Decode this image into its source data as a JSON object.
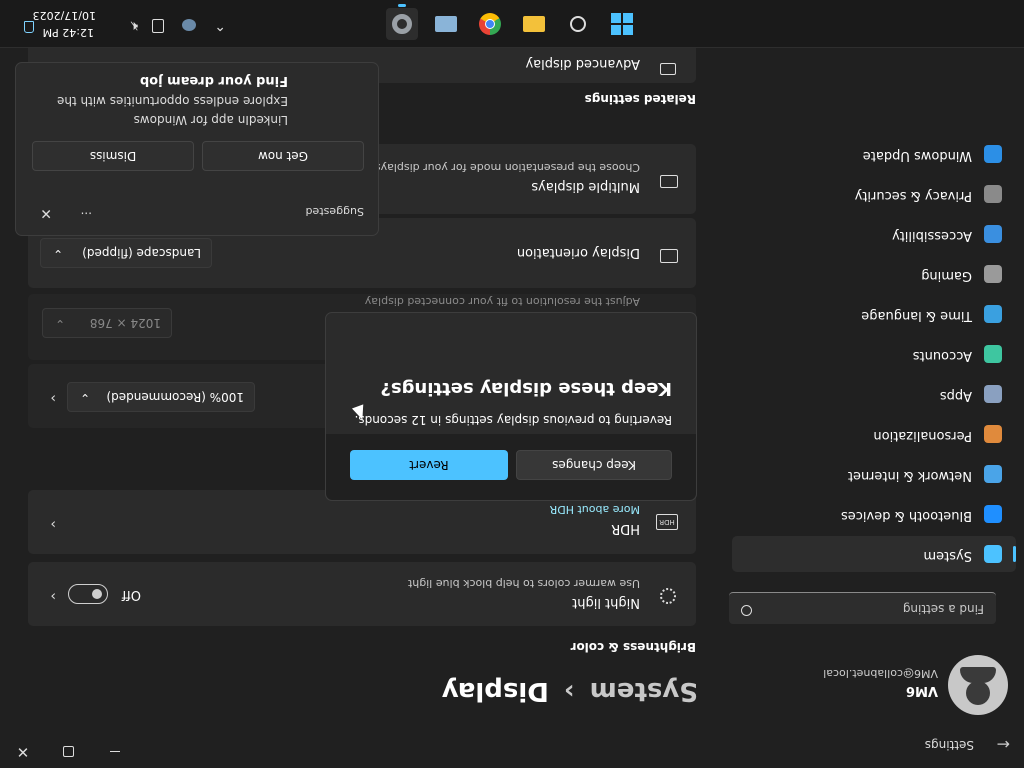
{
  "window": {
    "app_title": "Settings",
    "back_icon": "back-arrow-icon",
    "minimize_icon": "minimize-icon",
    "maximize_icon": "maximize-icon",
    "close_icon": "close-icon"
  },
  "profile": {
    "name": "VM6",
    "email": "VM6@collabnet.local"
  },
  "search": {
    "placeholder": "Find a setting"
  },
  "sidebar": {
    "items": [
      {
        "label": "System",
        "icon": "monitor-icon",
        "color": "#4cc2ff",
        "selected": true
      },
      {
        "label": "Bluetooth & devices",
        "icon": "bluetooth-icon",
        "color": "#1f8fff"
      },
      {
        "label": "Network & internet",
        "icon": "wifi-icon",
        "color": "#4aa4e8"
      },
      {
        "label": "Personalization",
        "icon": "brush-icon",
        "color": "#e08a3c"
      },
      {
        "label": "Apps",
        "icon": "apps-icon",
        "color": "#8aa0c0"
      },
      {
        "label": "Accounts",
        "icon": "person-icon",
        "color": "#3ec6a0"
      },
      {
        "label": "Time & language",
        "icon": "globe-clock-icon",
        "color": "#3aa0e0"
      },
      {
        "label": "Gaming",
        "icon": "gamepad-icon",
        "color": "#9a9a9a"
      },
      {
        "label": "Accessibility",
        "icon": "accessibility-icon",
        "color": "#3a8fe0"
      },
      {
        "label": "Privacy & security",
        "icon": "shield-icon",
        "color": "#8a8a8a"
      },
      {
        "label": "Windows Update",
        "icon": "sync-icon",
        "color": "#2c8fe6"
      }
    ]
  },
  "breadcrumb": {
    "parent": "System",
    "separator": "›",
    "current": "Display"
  },
  "sections": {
    "brightness": "Brightness & color",
    "related": "Related settings"
  },
  "night_light": {
    "title": "Night light",
    "subtitle": "Use warmer colors to help block blue light",
    "state": "Off"
  },
  "hdr": {
    "title": "HDR",
    "link": "More about HDR"
  },
  "scale": {
    "value": "100% (Recommended)"
  },
  "resolution": {
    "subtitle": "Adjust the resolution to fit your connected display",
    "value": "1024 × 768"
  },
  "orientation": {
    "title": "Display orientation",
    "value": "Landscape (flipped)"
  },
  "multiple_displays": {
    "title": "Multiple displays",
    "subtitle": "Choose the presentation mode for your displays"
  },
  "advanced_display": {
    "title": "Advanced display"
  },
  "dialog": {
    "title": "Keep these display settings?",
    "message": "Reverting to previous display settings in 12 seconds.",
    "keep_label": "Keep changes",
    "revert_label": "Revert"
  },
  "toast": {
    "header": "Suggested",
    "more": "···",
    "title": "Find your dream job",
    "body_line1": "Explore endless opportunities with the",
    "body_line2": "LinkedIn app for Windows",
    "get_now": "Get now",
    "dismiss": "Dismiss"
  },
  "taskbar": {
    "apps": [
      "start-icon",
      "search-icon",
      "file-explorer-icon",
      "chrome-icon",
      "task-manager-icon",
      "settings-icon"
    ],
    "tray": {
      "chevron": "chevron-up-icon",
      "time": "12:42 PM",
      "date": "10/17/2023"
    }
  },
  "colors": {
    "accent": "#4cc2ff",
    "link": "#99ebff",
    "window_bg": "#202020",
    "card_bg": "#2b2b2b"
  }
}
